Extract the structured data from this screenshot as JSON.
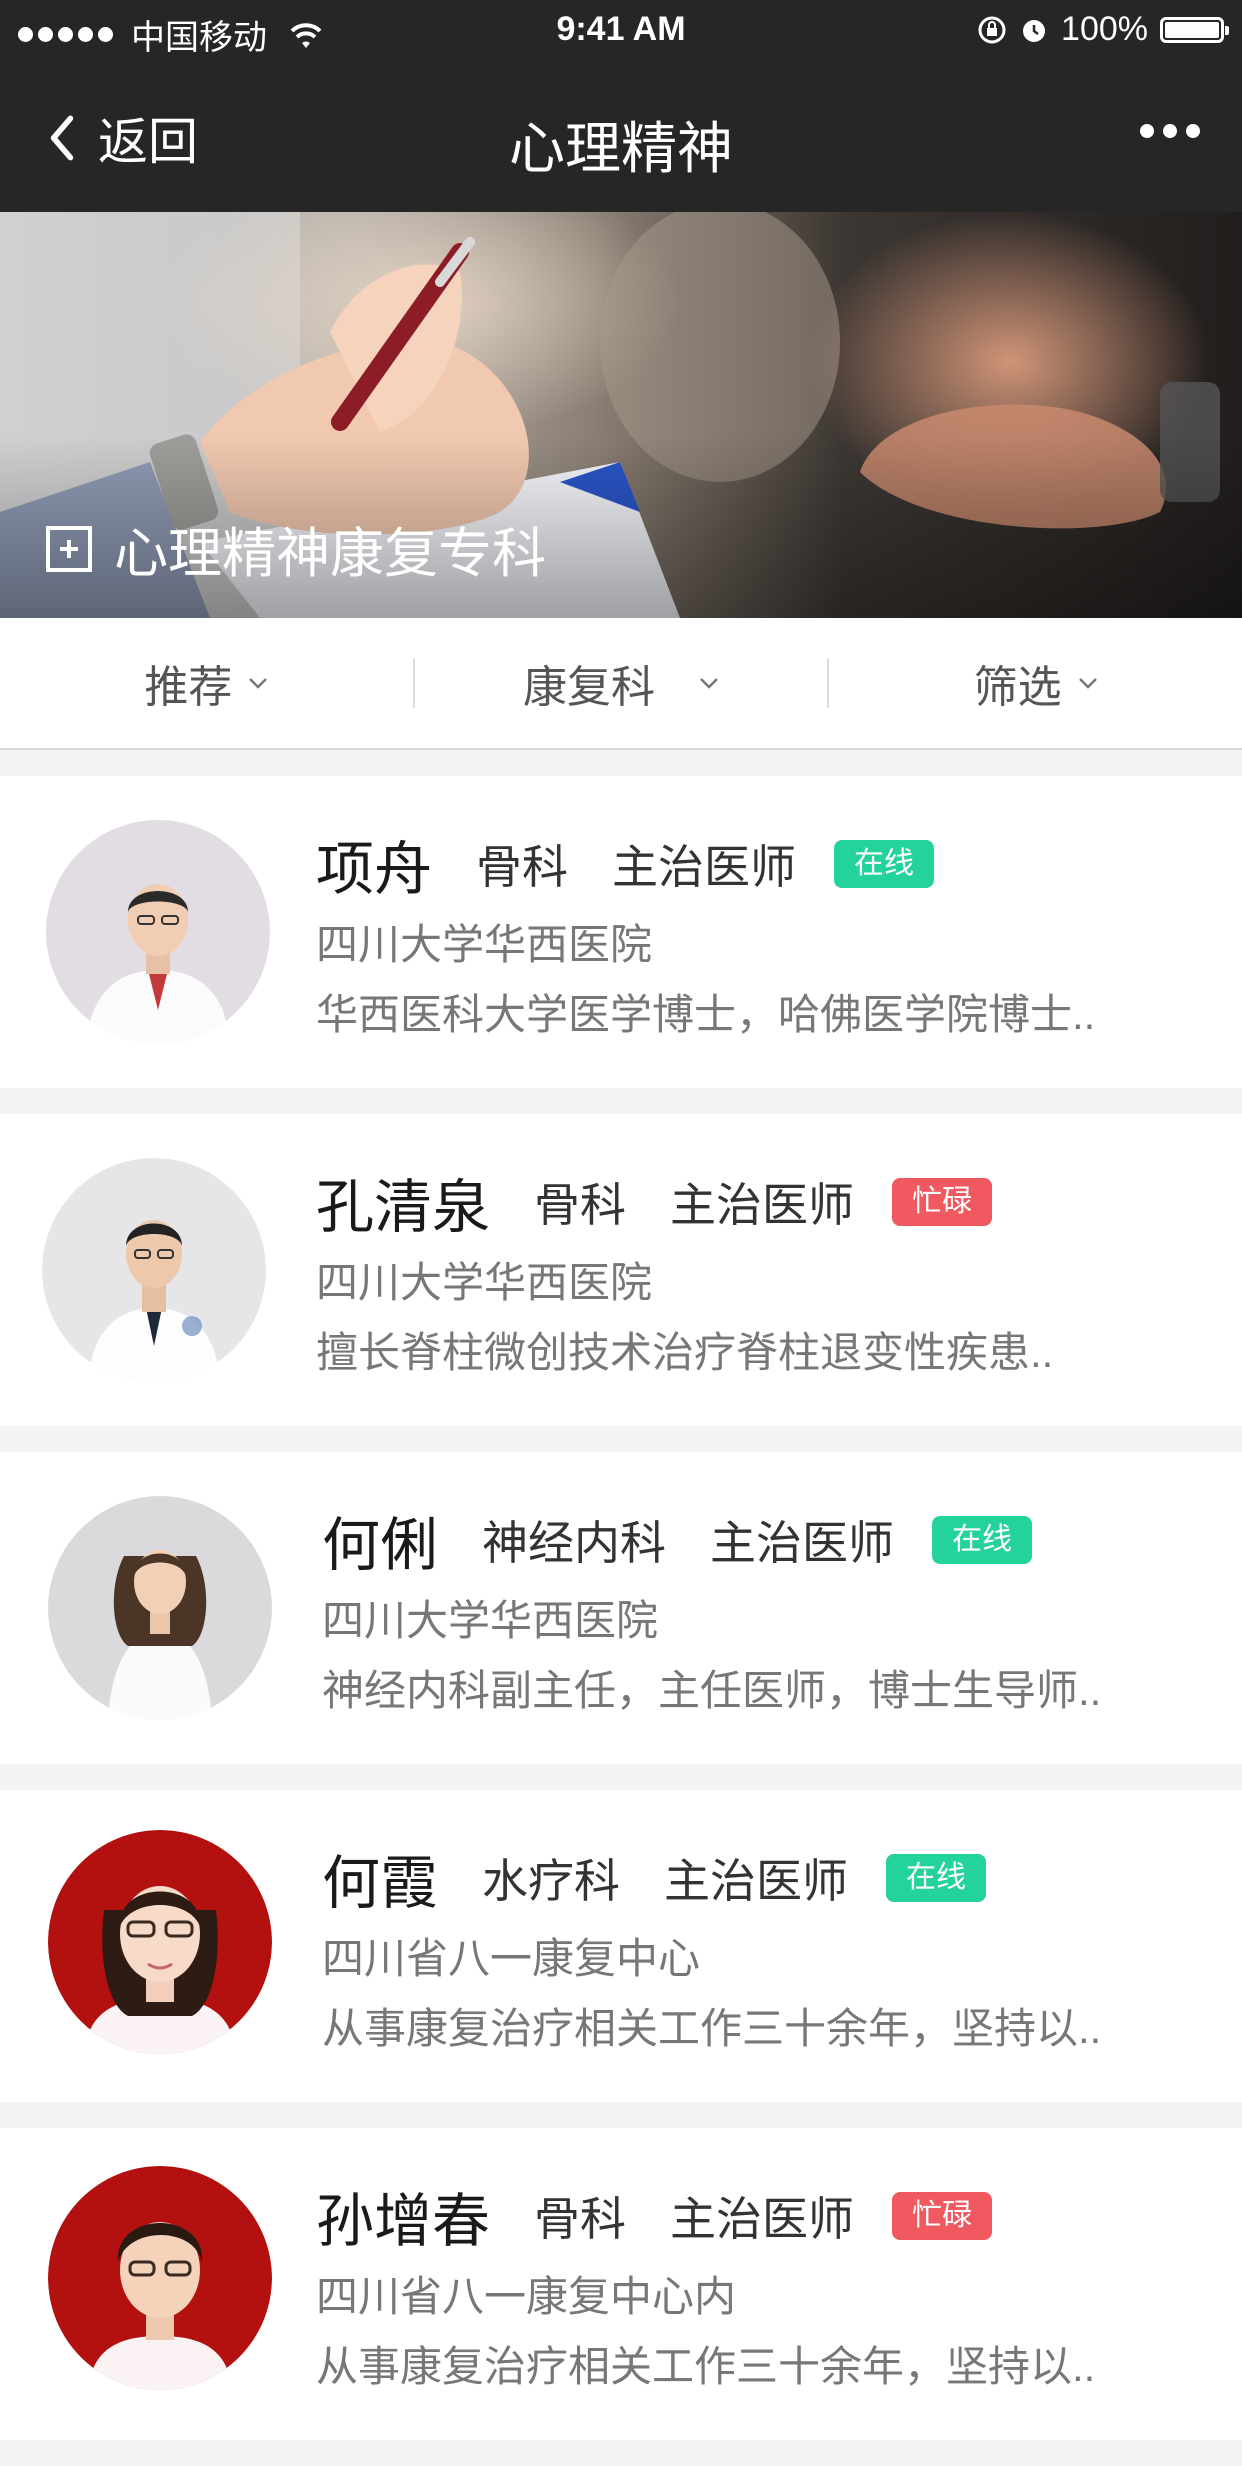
{
  "status_bar": {
    "carrier": "中国移动",
    "time": "9:41 AM",
    "battery": "100%",
    "battery_level": 1.0
  },
  "nav": {
    "back_label": "返回",
    "title": "心理精神"
  },
  "banner": {
    "label": "心理精神康复专科"
  },
  "filters": [
    {
      "label": "推荐"
    },
    {
      "label": "康复科"
    },
    {
      "label": "筛选"
    }
  ],
  "colors": {
    "online": "#24d39b",
    "busy": "#f0595f",
    "nav_bg": "#262626"
  },
  "doctors": [
    {
      "name": "项舟",
      "dept": "骨科",
      "title": "主治医师",
      "status": "在线",
      "status_type": "online",
      "hospital": "四川大学华西医院",
      "desc": "华西医科大学医学博士，哈佛医学院博士.."
    },
    {
      "name": "孔清泉",
      "dept": "骨科",
      "title": "主治医师",
      "status": "忙碌",
      "status_type": "busy",
      "hospital": "四川大学华西医院",
      "desc": "擅长脊柱微创技术治疗脊柱退变性疾患.."
    },
    {
      "name": "何俐",
      "dept": "神经内科",
      "title": "主治医师",
      "status": "在线",
      "status_type": "online",
      "hospital": "四川大学华西医院",
      "desc": "神经内科副主任，主任医师，博士生导师.."
    },
    {
      "name": "何霞",
      "dept": "水疗科",
      "title": "主治医师",
      "status": "在线",
      "status_type": "online",
      "hospital": "四川省八一康复中心",
      "desc": "从事康复治疗相关工作三十余年，坚持以.."
    },
    {
      "name": "孙增春",
      "dept": "骨科",
      "title": "主治医师",
      "status": "忙碌",
      "status_type": "busy",
      "hospital": "四川省八一康复中心内",
      "desc": "从事康复治疗相关工作三十余年，坚持以.."
    }
  ]
}
